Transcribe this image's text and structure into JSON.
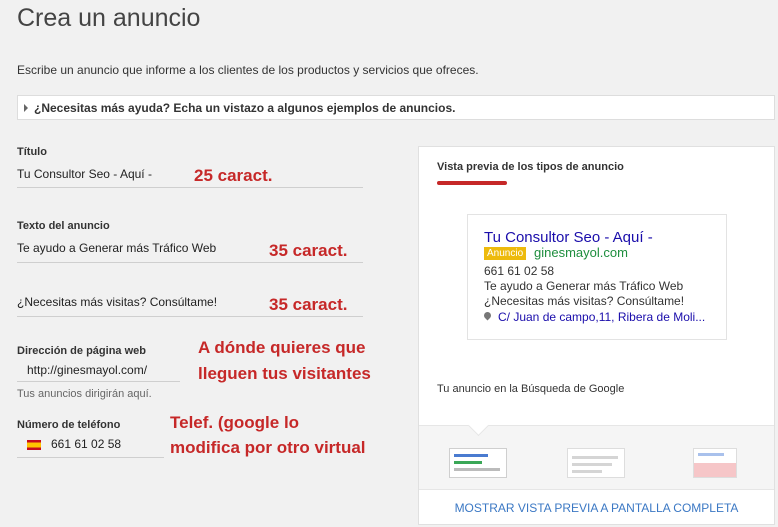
{
  "page": {
    "title": "Crea un anuncio",
    "subtitle": "Escribe un anuncio que informe a los clientes de los productos y servicios que ofreces.",
    "help_link": "¿Necesitas más ayuda? Echa un vistazo a algunos ejemplos de anuncios."
  },
  "form": {
    "title_label": "Título",
    "title_value": "Tu Consultor Seo - Aquí -",
    "text_label": "Texto del anuncio",
    "line1_value": "Te ayudo a Generar más Tráfico Web",
    "line2_value": "¿Necesitas más visitas? Consúltame!",
    "url_label": "Dirección de página web",
    "url_value": "http://ginesmayol.com/",
    "url_hint": "Tus anuncios dirigirán aquí.",
    "phone_label": "Número de teléfono",
    "phone_value": "661 61 02 58"
  },
  "annotations": {
    "title_chars": "25 caract.",
    "line1_chars": "35 caract.",
    "line2_chars": "35 caract.",
    "url_note_1": "A dónde quieres que",
    "url_note_2": "lleguen tus visitantes",
    "phone_note_1": "Telef. (google lo",
    "phone_note_2": "modifica por otro virtual"
  },
  "preview": {
    "title": "Vista previa de los tipos de anuncio",
    "ad": {
      "headline": "Tu Consultor Seo - Aquí -",
      "badge": "Anuncio",
      "display_url": "ginesmayol.com",
      "phone": "661 61 02 58",
      "line1": "Te ayudo a Generar más Tráfico Web",
      "line2": "¿Necesitas más visitas? Consúltame!",
      "address": "C/ Juan de campo,11, Ribera de Moli..."
    },
    "caption": "Tu anuncio en la Búsqueda de Google",
    "full_preview_link": "MOSTRAR VISTA PREVIA A PANTALLA COMPLETA"
  },
  "colors": {
    "accent_red": "#c62828",
    "link_blue": "#1a0dab",
    "url_green": "#1e8e3e",
    "badge_yellow": "#edba0c"
  }
}
